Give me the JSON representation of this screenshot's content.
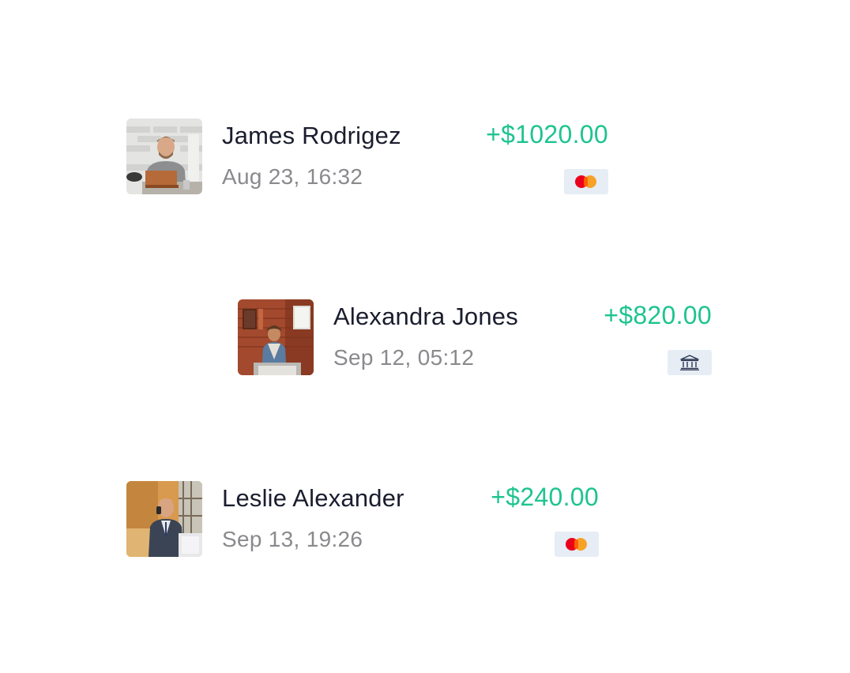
{
  "transactions": [
    {
      "name": "James Rodrigez",
      "date": "Aug 23, 16:32",
      "amount": "+$1020.00",
      "method": "mastercard-icon"
    },
    {
      "name": "Alexandra Jones",
      "date": "Sep 12, 05:12",
      "amount": "+$820.00",
      "method": "bank-icon"
    },
    {
      "name": "Leslie Alexander",
      "date": "Sep 13, 19:26",
      "amount": "+$240.00",
      "method": "mastercard-icon"
    }
  ],
  "colors": {
    "amount": "#1ec48f",
    "name": "#1a1d2e",
    "date": "#8a8a8e",
    "method_bg": "#e6edf5"
  }
}
